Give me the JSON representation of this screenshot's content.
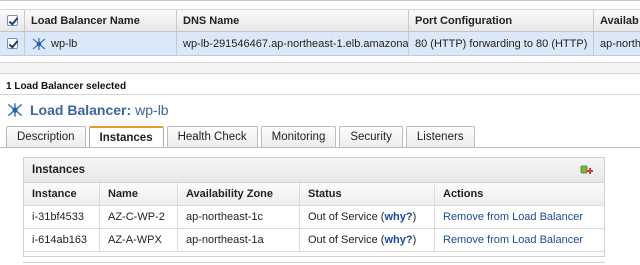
{
  "grid": {
    "columns": [
      "Load Balancer Name",
      "DNS Name",
      "Port Configuration",
      "Availab"
    ],
    "row": {
      "name": "wp-lb",
      "dns": "wp-lb-291546467.ap-northeast-1.elb.amazonaw",
      "port": "80 (HTTP) forwarding to 80 (HTTP)",
      "availability": "ap-north"
    }
  },
  "selection": {
    "text": "1 Load Balancer selected"
  },
  "detail": {
    "title_label": "Load Balancer:",
    "title_name": "wp-lb",
    "tabs": [
      "Description",
      "Instances",
      "Health Check",
      "Monitoring",
      "Security",
      "Listeners"
    ],
    "active_tab": "Instances"
  },
  "instances": {
    "title": "Instances",
    "columns": [
      "Instance",
      "Name",
      "Availability Zone",
      "Status",
      "Actions"
    ],
    "rows": [
      {
        "instance": "i-31bf4533",
        "name": "AZ-C-WP-2",
        "zone": "ap-northeast-1c",
        "status": "Out of Service",
        "status_open": "(",
        "why": "why?",
        "status_close": ")",
        "action": "Remove from Load Balancer"
      },
      {
        "instance": "i-614ab163",
        "name": "AZ-A-WPX",
        "zone": "ap-northeast-1a",
        "status": "Out of Service",
        "status_open": "(",
        "why": "why?",
        "status_close": ")",
        "action": "Remove from Load Balancer"
      }
    ]
  },
  "colors": {
    "accent": "#3c64a2",
    "link": "#1a4a9c",
    "active_tab": "#e89a2c",
    "selected_row": "#dbe8f7"
  },
  "icons": {
    "load_balancer": "load-balancer-icon",
    "add_instance": "add-instance-icon"
  }
}
